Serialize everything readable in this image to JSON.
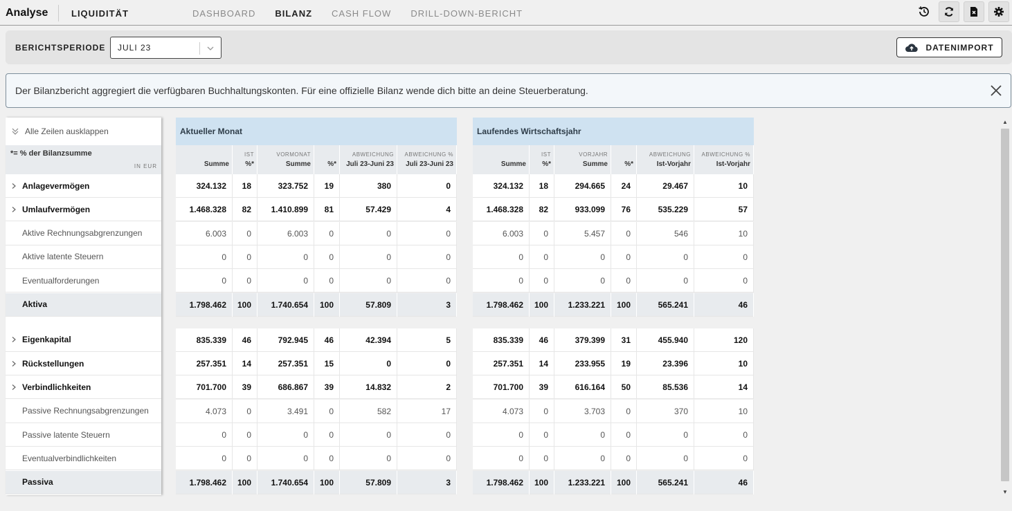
{
  "app": {
    "title": "Analyse",
    "module": "LIQUIDITÄT"
  },
  "nav": {
    "tabs": [
      "DASHBOARD",
      "BILANZ",
      "CASH FLOW",
      "DRILL-DOWN-BERICHT"
    ],
    "active": "BILANZ"
  },
  "top_icons": [
    "history-icon",
    "refresh-icon",
    "export-file-icon",
    "settings-icon"
  ],
  "filter": {
    "label": "BERICHTSPERIODE",
    "selected": "JULI 23",
    "import_label": "DATENIMPORT"
  },
  "info": {
    "text": "Der Bilanzbericht aggregiert die verfügbaren Buchhaltungskonten. Für eine offizielle Bilanz wende dich bitte an deine Steuerberatung."
  },
  "left": {
    "expand_all": "Alle Zeilen ausklappen",
    "percent_note": "*= % der Bilanzsumme",
    "unit": "IN EUR"
  },
  "groups": [
    {
      "title": "Aktueller Monat",
      "columns": [
        {
          "top": "",
          "bottom": "Summe"
        },
        {
          "top": "IST",
          "bottom": "%*"
        },
        {
          "top": "VORMONAT",
          "bottom": "Summe"
        },
        {
          "top": "",
          "bottom": "%*"
        },
        {
          "top": "ABWEICHUNG",
          "bottom": "Juli 23-Juni 23"
        },
        {
          "top": "ABWEICHUNG %",
          "bottom": "Juli 23-Juni 23"
        }
      ]
    },
    {
      "title": "Laufendes Wirtschaftsjahr",
      "columns": [
        {
          "top": "",
          "bottom": "Summe"
        },
        {
          "top": "IST",
          "bottom": "%*"
        },
        {
          "top": "VORJAHR",
          "bottom": "Summe"
        },
        {
          "top": "",
          "bottom": "%*"
        },
        {
          "top": "ABWEICHUNG",
          "bottom": "Ist-Vorjahr"
        },
        {
          "top": "ABWEICHUNG %",
          "bottom": "Ist-Vorjahr"
        }
      ]
    }
  ],
  "rows": [
    {
      "label": "Anlagevermögen",
      "kind": "bold",
      "expandable": true,
      "block": 0,
      "m": [
        "324.132",
        "18",
        "323.752",
        "19",
        "380",
        "0"
      ],
      "y": [
        "324.132",
        "18",
        "294.665",
        "24",
        "29.467",
        "10"
      ]
    },
    {
      "label": "Umlaufvermögen",
      "kind": "bold",
      "expandable": true,
      "block": 0,
      "m": [
        "1.468.328",
        "82",
        "1.410.899",
        "81",
        "57.429",
        "4"
      ],
      "y": [
        "1.468.328",
        "82",
        "933.099",
        "76",
        "535.229",
        "57"
      ]
    },
    {
      "label": "Aktive Rechnungsabgrenzungen",
      "kind": "normal",
      "expandable": false,
      "block": 0,
      "m": [
        "6.003",
        "0",
        "6.003",
        "0",
        "0",
        "0"
      ],
      "y": [
        "6.003",
        "0",
        "5.457",
        "0",
        "546",
        "10"
      ]
    },
    {
      "label": "Aktive latente Steuern",
      "kind": "normal",
      "expandable": false,
      "block": 0,
      "m": [
        "0",
        "0",
        "0",
        "0",
        "0",
        "0"
      ],
      "y": [
        "0",
        "0",
        "0",
        "0",
        "0",
        "0"
      ]
    },
    {
      "label": "Eventualforderungen",
      "kind": "normal",
      "expandable": false,
      "block": 0,
      "m": [
        "0",
        "0",
        "0",
        "0",
        "0",
        "0"
      ],
      "y": [
        "0",
        "0",
        "0",
        "0",
        "0",
        "0"
      ]
    },
    {
      "label": "Aktiva",
      "kind": "total",
      "expandable": false,
      "block": 0,
      "m": [
        "1.798.462",
        "100",
        "1.740.654",
        "100",
        "57.809",
        "3"
      ],
      "y": [
        "1.798.462",
        "100",
        "1.233.221",
        "100",
        "565.241",
        "46"
      ]
    },
    {
      "label": "Eigenkapital",
      "kind": "bold",
      "expandable": true,
      "block": 1,
      "m": [
        "835.339",
        "46",
        "792.945",
        "46",
        "42.394",
        "5"
      ],
      "y": [
        "835.339",
        "46",
        "379.399",
        "31",
        "455.940",
        "120"
      ]
    },
    {
      "label": "Rückstellungen",
      "kind": "bold",
      "expandable": true,
      "block": 1,
      "m": [
        "257.351",
        "14",
        "257.351",
        "15",
        "0",
        "0"
      ],
      "y": [
        "257.351",
        "14",
        "233.955",
        "19",
        "23.396",
        "10"
      ]
    },
    {
      "label": "Verbindlichkeiten",
      "kind": "bold",
      "expandable": true,
      "block": 1,
      "m": [
        "701.700",
        "39",
        "686.867",
        "39",
        "14.832",
        "2"
      ],
      "y": [
        "701.700",
        "39",
        "616.164",
        "50",
        "85.536",
        "14"
      ]
    },
    {
      "label": "Passive Rechnungsabgrenzungen",
      "kind": "normal",
      "expandable": false,
      "block": 1,
      "m": [
        "4.073",
        "0",
        "3.491",
        "0",
        "582",
        "17"
      ],
      "y": [
        "4.073",
        "0",
        "3.703",
        "0",
        "370",
        "10"
      ]
    },
    {
      "label": "Passive latente Steuern",
      "kind": "normal",
      "expandable": false,
      "block": 1,
      "m": [
        "0",
        "0",
        "0",
        "0",
        "0",
        "0"
      ],
      "y": [
        "0",
        "0",
        "0",
        "0",
        "0",
        "0"
      ]
    },
    {
      "label": "Eventualverbindlichkeiten",
      "kind": "normal",
      "expandable": false,
      "block": 1,
      "m": [
        "0",
        "0",
        "0",
        "0",
        "0",
        "0"
      ],
      "y": [
        "0",
        "0",
        "0",
        "0",
        "0",
        "0"
      ]
    },
    {
      "label": "Passiva",
      "kind": "total",
      "expandable": false,
      "block": 1,
      "m": [
        "1.798.462",
        "100",
        "1.740.654",
        "100",
        "57.809",
        "3"
      ],
      "y": [
        "1.798.462",
        "100",
        "1.233.221",
        "100",
        "565.241",
        "46"
      ]
    }
  ]
}
